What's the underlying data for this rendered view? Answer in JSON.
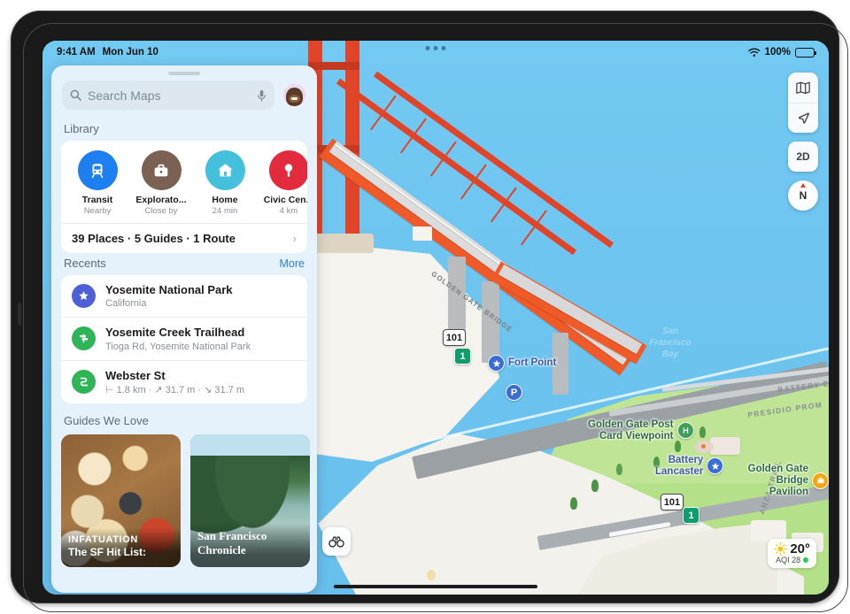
{
  "status_bar": {
    "time": "9:41 AM",
    "date": "Mon Jun 10",
    "wifi_icon": "wifi-icon",
    "battery_percent": "100%",
    "battery_icon": "battery-full-icon"
  },
  "multitask": {
    "icon": "multitask-dots-icon"
  },
  "sidebar": {
    "search": {
      "icon": "search-icon",
      "placeholder": "Search Maps",
      "value": "",
      "mic_icon": "microphone-icon",
      "avatar": "user-avatar"
    },
    "library": {
      "title": "Library",
      "items": [
        {
          "label": "Transit",
          "sub": "Nearby",
          "icon": "train-icon",
          "color": "#1d7ff0"
        },
        {
          "label": "Explorato...",
          "sub": "Close by",
          "icon": "briefcase-icon",
          "color": "#7a6154"
        },
        {
          "label": "Home",
          "sub": "24 min",
          "icon": "house-icon",
          "color": "#44c0dd"
        },
        {
          "label": "Civic Cen...",
          "sub": "4 km",
          "icon": "map-pin-icon",
          "color": "#e32b3e"
        },
        {
          "label": "",
          "sub": "",
          "icon": "place-icon",
          "color": "#f5822a"
        }
      ],
      "footer_label": "39 Places · 5 Guides · 1 Route",
      "footer_chevron": "chevron-right-icon"
    },
    "recents": {
      "title": "Recents",
      "more_label": "More",
      "items": [
        {
          "title": "Yosemite National Park",
          "sub": "California",
          "icon": "star-icon",
          "color": "#4f5fd7"
        },
        {
          "title": "Yosemite Creek Trailhead",
          "sub": "Tioga Rd, Yosemite National Park",
          "icon": "trail-sign-icon",
          "color": "#2fb457"
        },
        {
          "title": "Webster St",
          "sub": "⊢ 1.8 km · ↗ 31.7 m · ↘ 31.7 m",
          "icon": "route-icon",
          "color": "#2fb457"
        }
      ]
    },
    "guides": {
      "title": "Guides We Love",
      "cards": [
        {
          "brand": "INFATUATION",
          "title": "The SF Hit List:",
          "image": "food-table-photo"
        },
        {
          "brand": "San Francisco Chronicle",
          "title": "",
          "image": "bay-cove-photo"
        }
      ]
    }
  },
  "map": {
    "controls": [
      {
        "name": "map-layers-button",
        "icon": "map-layers-icon",
        "label": ""
      },
      {
        "name": "locate-button",
        "icon": "location-arrow-icon",
        "label": ""
      },
      {
        "name": "dimension-toggle-button",
        "icon": "",
        "label": "2D"
      }
    ],
    "compass": {
      "label": "N",
      "icon": "compass-icon"
    },
    "look_around": {
      "icon": "binoculars-icon"
    },
    "weather": {
      "icon": "sun-icon",
      "temperature": "20°",
      "aqi_label": "AQI 28"
    },
    "labels": {
      "bay": "San\nFrancisco\nBay",
      "bay_lines": [
        "San",
        "Francisco",
        "Bay"
      ],
      "pois": [
        {
          "label": "Fort Point",
          "icon": "star-poi-icon",
          "color": "#3b6cd4"
        },
        {
          "label": "Golden Gate Post\nCard Viewpoint",
          "icon": "viewpoint-icon",
          "color": "#3fa05a"
        },
        {
          "label": "Battery\nLancaster",
          "icon": "star-poi-icon",
          "color": "#3b6cd4"
        },
        {
          "label": "Golden Gate\nBridge Pavilion",
          "icon": "shop-icon",
          "color": "#f2a713"
        }
      ],
      "parking": {
        "label": "P",
        "icon": "parking-icon"
      },
      "road_shields": [
        {
          "label": "101",
          "type": "us-highway"
        },
        {
          "label": "1",
          "type": "state-route"
        },
        {
          "label": "101",
          "type": "us-highway"
        },
        {
          "label": "1",
          "type": "state-route"
        }
      ],
      "road_names": [
        "PRESIDIO PROM",
        "BATTERY E",
        "ANZA TRAIL"
      ],
      "bridge_name": "GOLDEN GATE BRIDGE"
    }
  }
}
